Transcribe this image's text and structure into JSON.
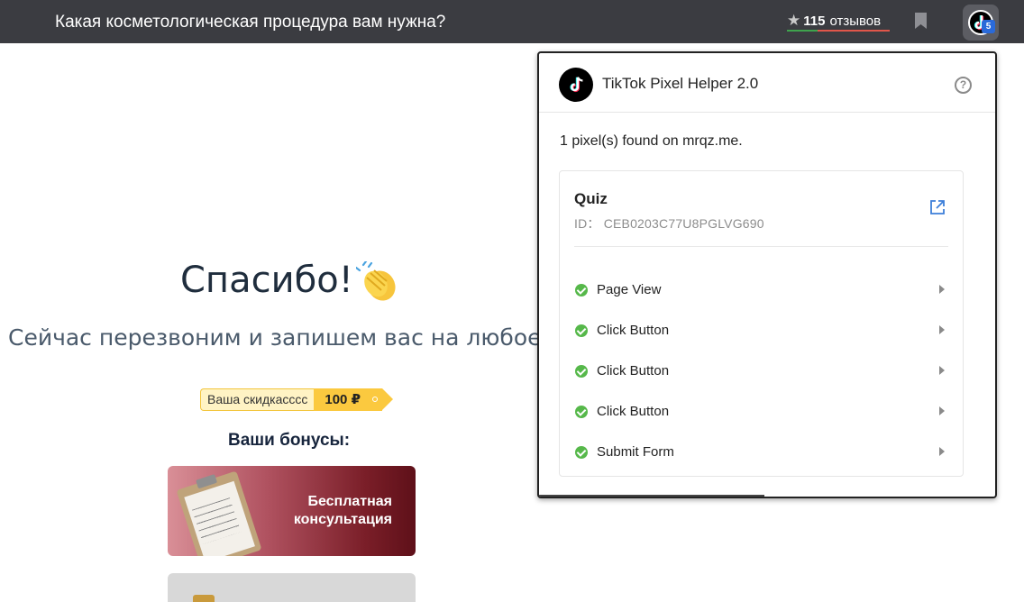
{
  "topbar": {
    "title": "Какая косметологическая процедура вам нужна?",
    "reviews_star": "★",
    "reviews_count": "115",
    "reviews_label": "отзывов",
    "extension_badge": "5"
  },
  "page": {
    "thanks": "Спасибо!",
    "subtitle": "Сейчас перезвоним и запишем вас на любое уд",
    "discount_label": "Ваша скидкасссс",
    "discount_value": "100 ₽",
    "bonuses_title": "Ваши бонусы:",
    "bonus_1_line1": "Бесплатная",
    "bonus_1_line2": "консультация"
  },
  "popup": {
    "title": "TikTok Pixel Helper 2.0",
    "help": "?",
    "found_text": "1 pixel(s) found on mrqz.me.",
    "pixel": {
      "name": "Quiz",
      "id": "ID：  CEB0203C77U8PGLVG690"
    },
    "events": [
      {
        "label": "Page View"
      },
      {
        "label": "Click Button"
      },
      {
        "label": "Click Button"
      },
      {
        "label": "Click Button"
      },
      {
        "label": "Submit Form"
      }
    ]
  },
  "colors": {
    "topbar_bg": "#3b3c41",
    "check_green": "#56b84a",
    "discount_yellow": "#fbc93f",
    "badge_blue": "#2a6ad9"
  },
  "icons": [
    "star-icon",
    "bookmark-icon",
    "tiktok-logo-icon",
    "help-icon",
    "open-external-icon",
    "check-circle-icon",
    "chevron-right-icon",
    "clapping-hands-icon",
    "clipboard-icon"
  ]
}
